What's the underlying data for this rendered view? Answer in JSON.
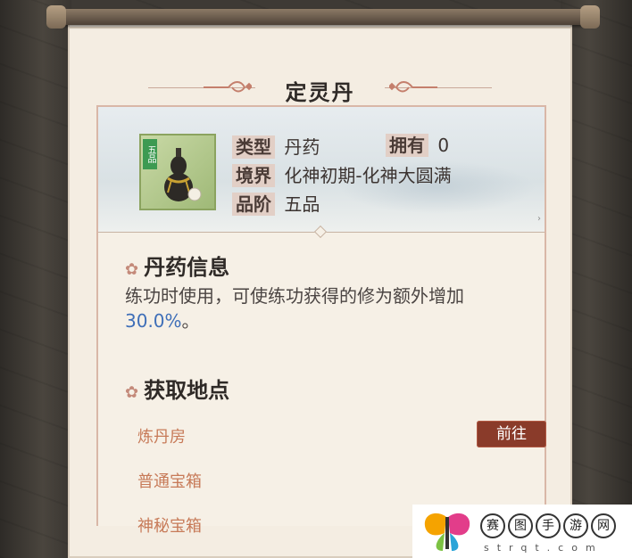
{
  "item": {
    "title": "定灵丹",
    "grade_tag": "五品",
    "attrs": {
      "type_label": "类型",
      "type_value": "丹药",
      "own_label": "拥有",
      "own_value": "0",
      "realm_label": "境界",
      "realm_value": "化神初期-化神大圆满",
      "rank_label": "品阶",
      "rank_value": "五品"
    }
  },
  "info_section": {
    "heading": "丹药信息",
    "desc_prefix": "练功时使用，可使练功获得的修为额外增加",
    "desc_highlight": "30.0%",
    "desc_suffix": "。"
  },
  "source_section": {
    "heading": "获取地点",
    "items": [
      {
        "label": "炼丹房",
        "button": "前往"
      },
      {
        "label": "普通宝箱"
      },
      {
        "label": "神秘宝箱"
      }
    ]
  },
  "watermark": {
    "chars": [
      "赛",
      "图",
      "手",
      "游",
      "网"
    ],
    "sub": "strqt.com"
  },
  "icons": {
    "flower": "flower-icon",
    "pill_gourd": "gourd-icon",
    "title_ornament": "cloud-ornament-icon"
  },
  "colors": {
    "accent": "#8a3b2a",
    "source_text": "#c77a58",
    "highlight": "#3f6fb8",
    "paper": "#f4ede2"
  }
}
